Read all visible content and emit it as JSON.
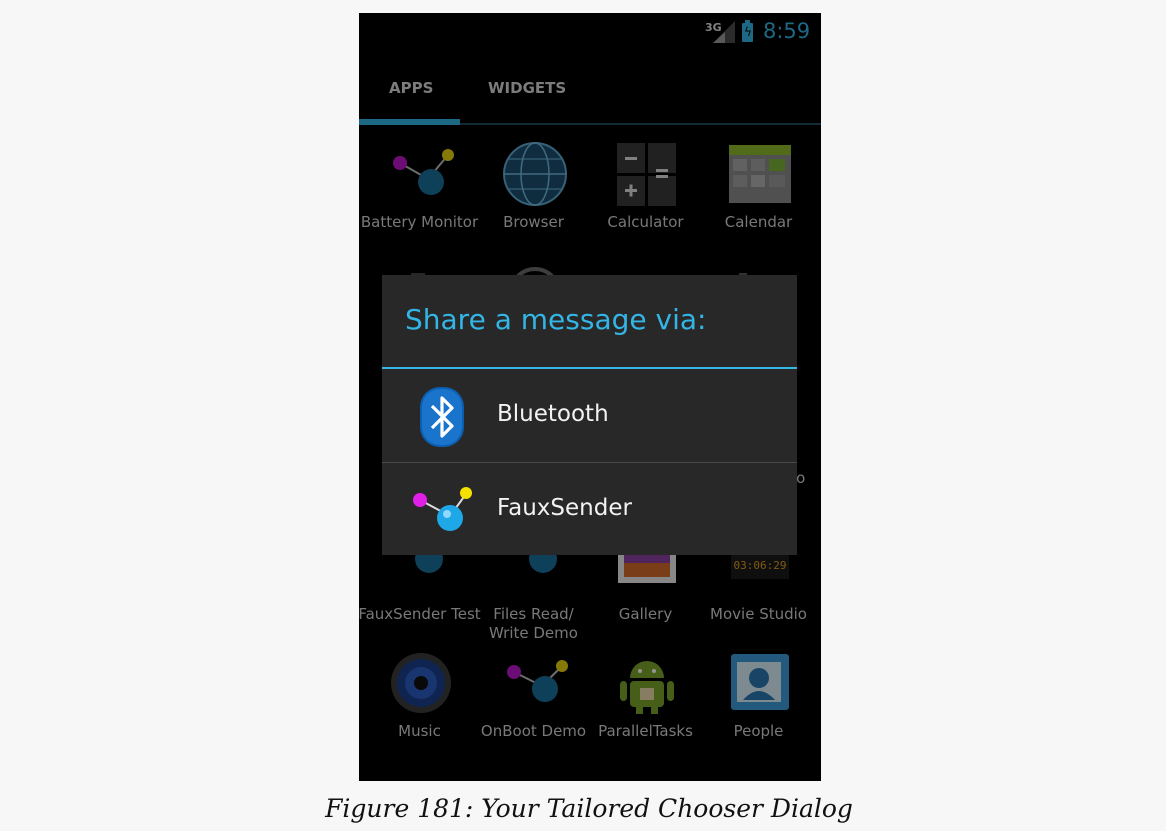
{
  "status_bar": {
    "network": "3G",
    "time": "8:59",
    "accent": "#33b5e5"
  },
  "tabs": {
    "apps": "APPS",
    "widgets": "WIDGETS"
  },
  "apps": [
    {
      "label": "Battery Monitor",
      "icon": "molecule-icon"
    },
    {
      "label": "Browser",
      "icon": "globe-icon"
    },
    {
      "label": "Calculator",
      "icon": "calculator-icon"
    },
    {
      "label": "Calendar",
      "icon": "calendar-icon"
    },
    {
      "label": "FauxSender Test",
      "icon": "molecule-icon"
    },
    {
      "label": "Files Read/ Write Demo",
      "icon": "molecule-icon"
    },
    {
      "label": "Gallery",
      "icon": "gallery-icon"
    },
    {
      "label": "Movie Studio",
      "icon": "movie-studio-icon"
    },
    {
      "label": "Music",
      "icon": "speaker-icon"
    },
    {
      "label": "OnBoot Demo",
      "icon": "molecule-icon"
    },
    {
      "label": "ParallelTasks",
      "icon": "android-icon"
    },
    {
      "label": "People",
      "icon": "contacts-icon"
    }
  ],
  "partial_label": "io",
  "movie_clock": "03:06:29",
  "dialog": {
    "title": "Share a message via:",
    "options": [
      {
        "label": "Bluetooth",
        "icon": "bluetooth-icon"
      },
      {
        "label": "FauxSender",
        "icon": "molecule-icon"
      }
    ]
  },
  "caption": "Figure 181: Your Tailored Chooser Dialog"
}
